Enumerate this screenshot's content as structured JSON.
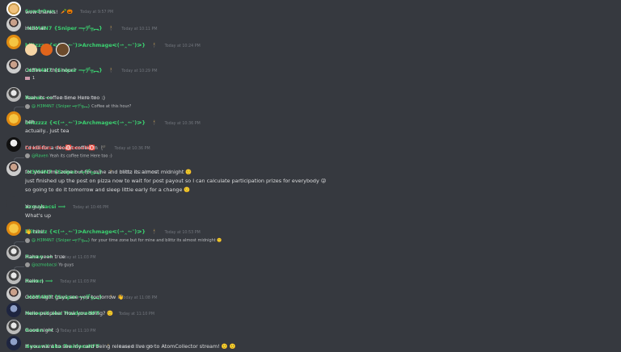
{
  "messages": [
    {
      "id": "m1",
      "avatar": "sundr",
      "user": "Sundr0wn",
      "badge": "🥕🎃",
      "ts": "Today at 9:57 PM",
      "lines": [
        "wow thanks!"
      ]
    },
    {
      "id": "m2",
      "avatar": "h3m",
      "user": ".H3M4N7 {Sniper ━╤デ╦︻}",
      "badge": "🕴",
      "ts": "Today at 10:11 PM",
      "lines": [
        "Hello all"
      ]
    },
    {
      "id": "m3",
      "avatar": "blitz",
      "user": "blitzzzz {ᕙ(⇀‸↼‶)ᕗArchmageᕙ(⇀‸↼‶)ᕗ}",
      "badge": "🕴",
      "ts": "Today at 10:24 PM",
      "emojis": [
        "👋",
        "🔥",
        "☕"
      ]
    },
    {
      "id": "m4",
      "avatar": "h3m",
      "user": ".H3M4N7 {Sniper ━╤デ╦︻}",
      "badge": "🕴",
      "ts": "Today at 10:29 PM",
      "lines": [
        "Coffee at this hour?"
      ],
      "reaction": "1"
    },
    {
      "id": "m5",
      "avatar": "raven",
      "user": "Raven ⟹",
      "badge": "",
      "ts": "Today at 10:30 PM",
      "lines": [
        "Yeah its coffee time Here too :)"
      ]
    },
    {
      "id": "m6",
      "avatar": "blitz",
      "reply": {
        "name": "@.H3M4N7 {Sniper ━╤デ╦︻}",
        "text": "Coffee at this hour?"
      },
      "user": "blitzzzz {ᕙ(⇀‸↼‶)ᕗArchmageᕙ(⇀‸↼‶)ᕗ}",
      "badge": "🕴",
      "ts": "Today at 10:36 PM",
      "lines": [
        "heh",
        "actually.. just tea"
      ]
    },
    {
      "id": "m7",
      "avatar": "cre",
      "user": "CreGidas ⚡Ne🅾️omeN🅾️",
      "badge": "🏴",
      "ts": "Today at 10:36 PM",
      "lines": [
        "I'd kill for a decent coffee rn"
      ],
      "red": true
    },
    {
      "id": "m8",
      "avatar": "h3m",
      "reply": {
        "name": "@Raven",
        "text": "Yeah its coffee time Here too :)"
      },
      "user": ".H3M4N7 {Sniper ━╤デ╦︻}",
      "badge": "🕴",
      "ts": "Today at 10:37 PM",
      "lines": [
        "for your time zone but for mine and blittz its almost midnight 🙂",
        "just finished up the post on pizza now to wait for post payout so I can calculate participation prizes for everybody 😜",
        "so going to do it tomorrow and sleep little early for a change 🙂"
      ]
    },
    {
      "id": "m9",
      "avatar": "raven",
      "user": "azmobacsi ⟹",
      "badge": "",
      "ts": "Today at 10:46 PM",
      "lines": [
        "Yo guys",
        "What's up"
      ]
    },
    {
      "id": "m10",
      "avatar": "blitz",
      "user": "blitzzzz {ᕙ(⇀‸↼‶)ᕗArchmageᕙ(⇀‸↼‶)ᕗ}",
      "badge": "🕴",
      "ts": "Today at 10:53 PM",
      "lines": [
        "👋 hihi!"
      ]
    },
    {
      "id": "m11",
      "avatar": "raven",
      "reply": {
        "name": "@.H3M4N7 {Sniper ━╤デ╦︻}",
        "text": "for your time zone but for mine and blittz its almost midnight 🙂"
      },
      "user": "Raven ⟹",
      "badge": "",
      "ts": "Today at 11:03 PM",
      "lines": [
        "Haha yeah true"
      ]
    },
    {
      "id": "m12",
      "avatar": "raven",
      "reply": {
        "name": "@azmobacsi",
        "text": "Yo guys"
      },
      "user": "Raven ⟹",
      "badge": "",
      "ts": "Today at 11:03 PM",
      "lines": [
        "Hello :)"
      ]
    },
    {
      "id": "m13",
      "avatar": "h3m",
      "user": ".H3M4N7 {Sniper ━╤デ╦︻}",
      "badge": "🕴",
      "ts": "Today at 11:08 PM",
      "lines": [
        "Good night guys see you tomorrow 👋"
      ]
    },
    {
      "id": "m14",
      "avatar": "newen",
      "user": "NewenX aka TraidoroNFT",
      "badge": "🕴",
      "ts": "Today at 11:10 PM",
      "lines": [
        "Hello peoplee! How you doing? 🙂"
      ]
    },
    {
      "id": "m15",
      "avatar": "raven",
      "user": "Raven ⟹",
      "badge": "",
      "ts": "Today at 11:10 PM",
      "lines": [
        "Good night :)"
      ]
    },
    {
      "id": "m16",
      "avatar": "newen",
      "user": "NewenX aka TraidoroNFT",
      "badge": "🕴",
      "ts": "Today at 11:10 PM",
      "lines": [
        "If you want to see my card being released live go to AtomCollector stream! 🙂 🙂"
      ]
    }
  ]
}
